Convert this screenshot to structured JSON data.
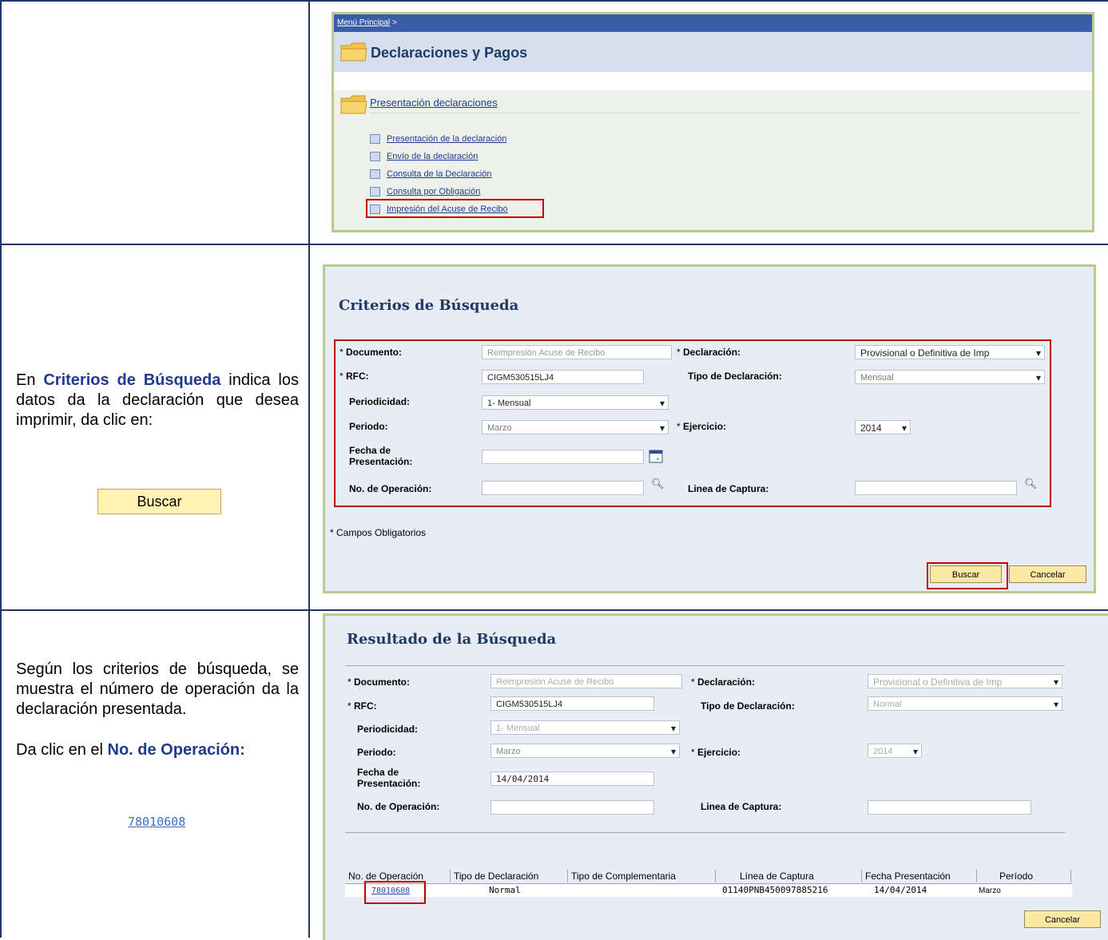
{
  "row1": {
    "breadcrumb": "Menú Principal",
    "breadcrumb_sep": ">",
    "header_title": "Declaraciones y Pagos",
    "section_title": "Presentación declaraciones",
    "links": [
      "Presentación de la declaración",
      "Envío de la declaración",
      "Consulta de la Declaración",
      "Consulta por Obligación",
      "Impresión del Acuse de Recibo"
    ]
  },
  "row2": {
    "instr_prefix": "En",
    "instr_bold": "Criterios de Búsqueda",
    "instr_rest": "indica los datos da la declaración que desea imprimir, da clic en:",
    "instr_button": "Buscar",
    "panel_title": "Criterios de Búsqueda",
    "labels": {
      "documento": "Documento:",
      "rfc": "RFC:",
      "periodicidad": "Periodicidad:",
      "periodo": "Periodo:",
      "fecha": "Fecha de Presentación:",
      "no_operacion": "No. de Operación:",
      "declaracion": "Declaración:",
      "tipo": "Tipo de Declaración:",
      "ejercicio": "Ejercicio:",
      "linea": "Linea de Captura:"
    },
    "values": {
      "documento": "Reimpresión Acuse de Recibo",
      "rfc": "CIGM530515LJ4",
      "periodicidad": "1- Mensual",
      "periodo": "Marzo",
      "fecha": "",
      "no_operacion": "",
      "declaracion": "Provisional o Definitiva de Imp",
      "tipo": "Mensual",
      "ejercicio": "2014",
      "linea": ""
    },
    "required_note": "* Campos Obligatorios",
    "buscar": "Buscar",
    "cancelar": "Cancelar"
  },
  "row3": {
    "instr1": "Según los criterios de búsqueda, se muestra el número de operación da la declaración presentada.",
    "instr2_prefix": "Da clic en el",
    "instr2_bold": "No. de Operación:",
    "instr_link": "78010608",
    "panel_title": "Resultado de la Búsqueda",
    "values": {
      "documento": "Reimpresión Acuse de Recibo",
      "rfc": "CIGM530515LJ4",
      "periodicidad": "1- Mensual",
      "periodo": "Marzo",
      "fecha": "14/04/2014",
      "no_operacion": "",
      "declaracion": "Provisional o Definitiva de Imp",
      "tipo": "Normal",
      "ejercicio": "2014",
      "linea": ""
    },
    "columns": [
      "No. de Operación",
      "Tipo de Declaración",
      "Tipo de Complementaria",
      "Línea de Captura",
      "Fecha Presentación",
      "Período"
    ],
    "row": {
      "no_operacion": "78010608",
      "tipo": "Normal",
      "complementaria": "",
      "linea": "01140PNB450097885216",
      "fecha": "14/04/2014",
      "periodo": "Marzo"
    },
    "cancelar": "Cancelar"
  }
}
